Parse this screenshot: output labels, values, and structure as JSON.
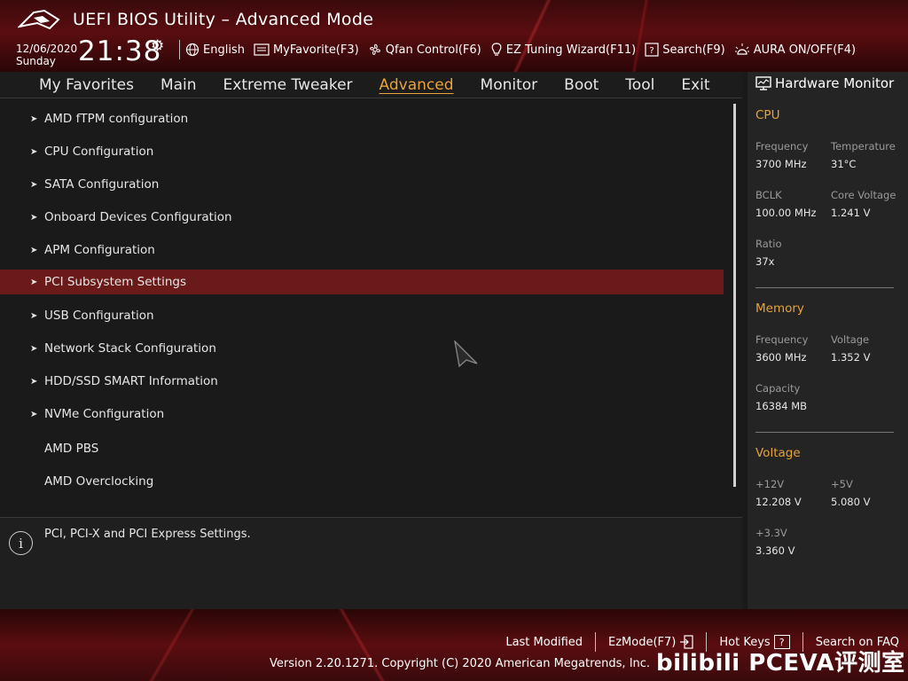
{
  "header": {
    "title": "UEFI BIOS Utility – Advanced Mode",
    "date": "12/06/2020",
    "day": "Sunday",
    "time": "21:38",
    "toolbar": [
      {
        "label": "English",
        "icon": "globe-icon"
      },
      {
        "label": "MyFavorite(F3)",
        "icon": "favorite-icon"
      },
      {
        "label": "Qfan Control(F6)",
        "icon": "fan-icon"
      },
      {
        "label": "EZ Tuning Wizard(F11)",
        "icon": "lightbulb-icon"
      },
      {
        "label": "Search(F9)",
        "icon": "search-box-icon"
      },
      {
        "label": "AURA ON/OFF(F4)",
        "icon": "aura-icon"
      }
    ]
  },
  "nav": {
    "tabs": [
      "My Favorites",
      "Main",
      "Extreme Tweaker",
      "Advanced",
      "Monitor",
      "Boot",
      "Tool",
      "Exit"
    ],
    "active": "Advanced"
  },
  "menu": {
    "items": [
      {
        "label": "AMD fTPM configuration",
        "submenu": true
      },
      {
        "label": "CPU Configuration",
        "submenu": true
      },
      {
        "label": "SATA Configuration",
        "submenu": true
      },
      {
        "label": "Onboard Devices Configuration",
        "submenu": true
      },
      {
        "label": "APM Configuration",
        "submenu": true
      },
      {
        "label": "PCI Subsystem Settings",
        "submenu": true,
        "selected": true
      },
      {
        "label": "USB Configuration",
        "submenu": true
      },
      {
        "label": "Network Stack Configuration",
        "submenu": true
      },
      {
        "label": "HDD/SSD SMART Information",
        "submenu": true
      },
      {
        "label": "NVMe Configuration",
        "submenu": true
      },
      {
        "label": "AMD PBS",
        "submenu": false
      },
      {
        "label": "AMD Overclocking",
        "submenu": false
      }
    ]
  },
  "help": {
    "text": "PCI, PCI-X and PCI Express Settings."
  },
  "hardware_monitor": {
    "title": "Hardware Monitor",
    "cpu": {
      "title": "CPU",
      "frequency_label": "Frequency",
      "frequency": "3700 MHz",
      "temperature_label": "Temperature",
      "temperature": "31°C",
      "bclk_label": "BCLK",
      "bclk": "100.00 MHz",
      "core_voltage_label": "Core Voltage",
      "core_voltage": "1.241 V",
      "ratio_label": "Ratio",
      "ratio": "37x"
    },
    "memory": {
      "title": "Memory",
      "frequency_label": "Frequency",
      "frequency": "3600 MHz",
      "voltage_label": "Voltage",
      "voltage": "1.352 V",
      "capacity_label": "Capacity",
      "capacity": "16384 MB"
    },
    "voltage": {
      "title": "Voltage",
      "v12_label": "+12V",
      "v12": "12.208 V",
      "v5_label": "+5V",
      "v5": "5.080 V",
      "v33_label": "+3.3V",
      "v33": "3.360 V"
    }
  },
  "footer": {
    "last_modified": "Last Modified",
    "ezmode": "EzMode(F7)",
    "hot_keys": "Hot Keys",
    "hot_keys_box": "?",
    "search_faq": "Search on FAQ",
    "copyright": "Version 2.20.1271. Copyright (C) 2020 American Megatrends, Inc.",
    "watermark": "bilibili PCEVA评测室"
  },
  "colors": {
    "accent": "#e8a33a",
    "selected_row": "#6b1a1a",
    "header_red": "#5a0d10"
  }
}
